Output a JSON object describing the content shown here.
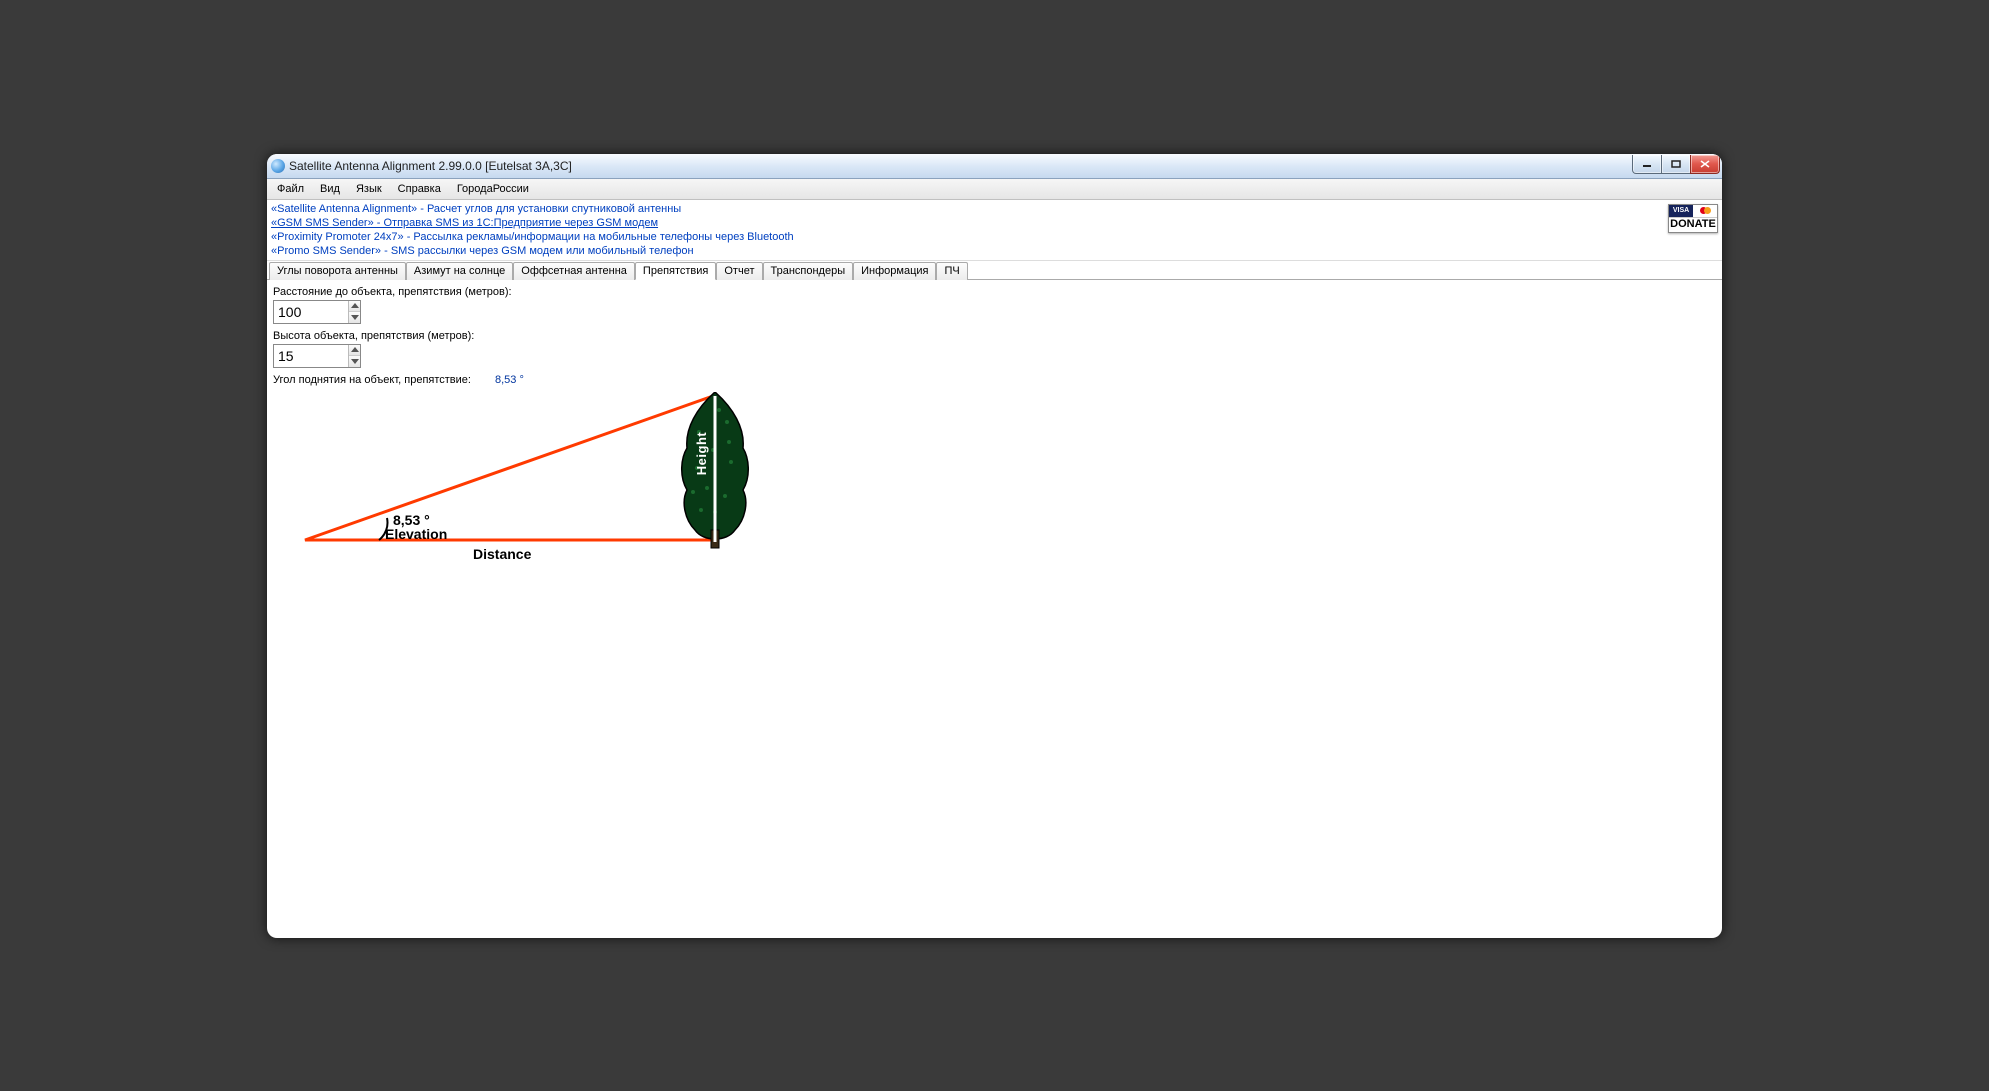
{
  "window": {
    "title": "Satellite Antenna Alignment 2.99.0.0 [Eutelsat 3A,3C]"
  },
  "menu": {
    "file": "Файл",
    "view": "Вид",
    "lang": "Язык",
    "help": "Справка",
    "cities": "ГородаРоссии"
  },
  "links": {
    "l1": "«Satellite Antenna Alignment» - Расчет углов для установки спутниковой антенны",
    "l2": "«GSM SMS Sender» - Отправка SMS из 1С:Предприятие через GSM модем",
    "l3": "«Proximity Promoter 24x7» - Рассылка рекламы/информации на мобильные телефоны через Bluetooth",
    "l4": "«Promo SMS Sender» - SMS рассылки через GSM модем или мобильный телефон"
  },
  "donate": {
    "visa": "VISA",
    "label": "DONATE"
  },
  "tabs": {
    "t0": "Углы поворота антенны",
    "t1": "Азимут на солнце",
    "t2": "Оффсетная антенна",
    "t3": "Препятствия",
    "t4": "Отчет",
    "t5": "Транспондеры",
    "t6": "Информация",
    "t7": "ПЧ"
  },
  "form": {
    "distance_label": "Расстояние до объекта, препятствия (метров):",
    "distance_value": "100",
    "height_label": "Высота объекта, препятствия (метров):",
    "height_value": "15",
    "result_label": "Угол поднятия на объект, препятствие:",
    "result_value": "8,53 °"
  },
  "diagram": {
    "angle": "8,53 °",
    "elevation": "Elevation",
    "distance": "Distance",
    "height": "Height"
  }
}
